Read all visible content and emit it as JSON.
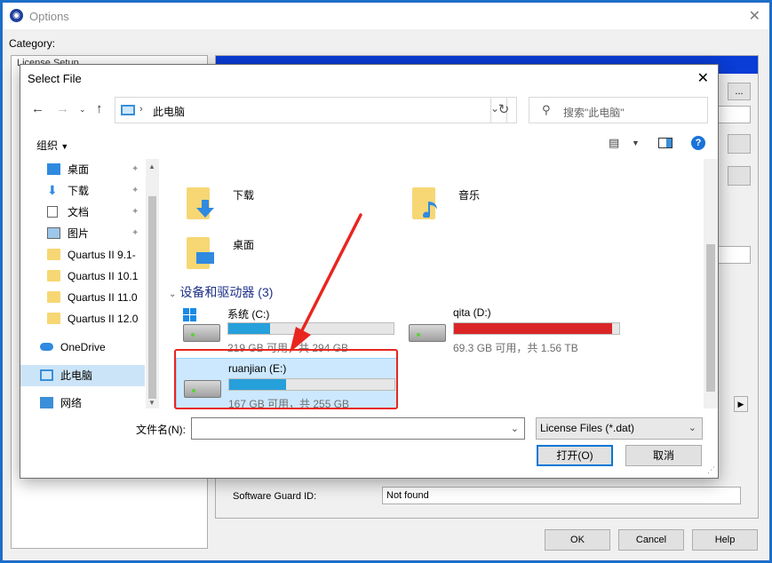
{
  "options": {
    "title": "Options",
    "category_label": "Category:",
    "category_item": "License Setup",
    "browse_label": "...",
    "software_guard_label": "Software Guard ID:",
    "software_guard_value": "Not found",
    "ok_label": "OK",
    "cancel_label": "Cancel",
    "help_label": "Help"
  },
  "dialog": {
    "title": "Select File",
    "address_path": "此电脑",
    "search_placeholder": "搜索\"此电脑\"",
    "organize_label": "组织",
    "nav_items": [
      {
        "label": "桌面",
        "icon": "desktop-icon"
      },
      {
        "label": "下载",
        "icon": "download-icon"
      },
      {
        "label": "文档",
        "icon": "document-icon"
      },
      {
        "label": "图片",
        "icon": "pictures-icon"
      },
      {
        "label": "Quartus II 9.1-",
        "icon": "folder-icon"
      },
      {
        "label": "Quartus II 10.1",
        "icon": "folder-icon"
      },
      {
        "label": "Quartus II 11.0",
        "icon": "folder-icon"
      },
      {
        "label": "Quartus II 12.0",
        "icon": "folder-icon"
      },
      {
        "label": "OneDrive",
        "icon": "onedrive-icon"
      },
      {
        "label": "此电脑",
        "icon": "this-pc-icon"
      },
      {
        "label": "网络",
        "icon": "network-icon"
      }
    ],
    "folders": [
      {
        "name": "下载"
      },
      {
        "name": "音乐"
      },
      {
        "name": "桌面"
      }
    ],
    "group_header": "设备和驱动器 (3)",
    "drives": [
      {
        "name": "系统 (C:)",
        "free_text": "219 GB 可用，共 294 GB",
        "used_fraction": 0.255
      },
      {
        "name": "qita (D:)",
        "free_text": "69.3 GB 可用，共 1.56 TB",
        "used_fraction": 0.957
      },
      {
        "name": "ruanjian (E:)",
        "free_text": "167 GB 可用，共 255 GB",
        "used_fraction": 0.345
      }
    ],
    "filename_label": "文件名(N):",
    "filename_value": "",
    "filter_value": "License Files (*.dat)",
    "open_label": "打开(O)",
    "cancel_label": "取消"
  },
  "colors": {
    "accent_blue": "#0078d7",
    "drive_bar": "#26a0da",
    "drive_bar_full": "#da2626",
    "annotation_red": "#e8261f"
  }
}
